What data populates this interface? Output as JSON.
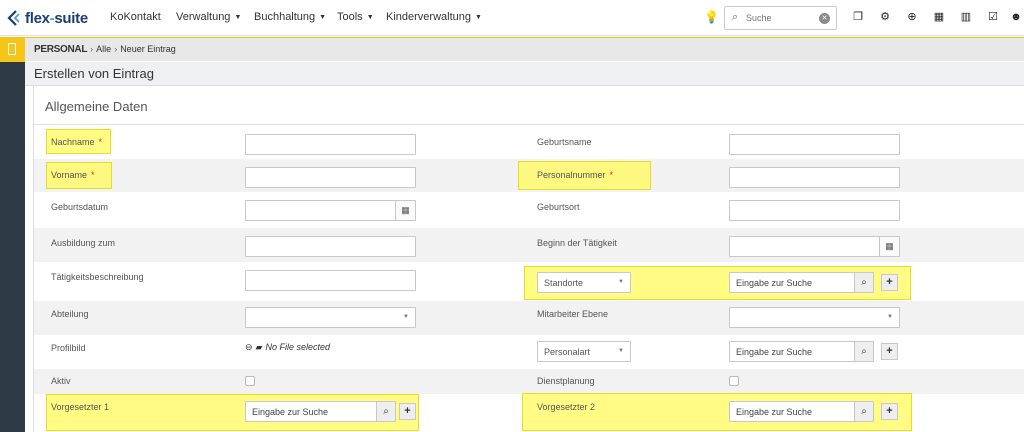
{
  "app": {
    "logo_text_a": "flex",
    "logo_text_dash": "-",
    "logo_text_b": "suite"
  },
  "nav": {
    "items": [
      {
        "label": "KoKontakt",
        "dropdown": false
      },
      {
        "label": "Verwaltung",
        "dropdown": true
      },
      {
        "label": "Buchhaltung",
        "dropdown": true
      },
      {
        "label": "Tools",
        "dropdown": true
      },
      {
        "label": "Kinderverwaltung",
        "dropdown": true
      }
    ],
    "search_placeholder": "Suche",
    "toolbar_icons": [
      "lightbulb-icon",
      "search-icon",
      "clear-icon",
      "documents-icon",
      "gear-icon",
      "plus-circle-icon",
      "calendar-icon",
      "bar-chart-icon",
      "checkbox-icon",
      "user-icon"
    ]
  },
  "breadcrumb": {
    "section": "PERSONAL",
    "level1": "Alle",
    "level2": "Neuer Eintrag"
  },
  "page": {
    "title": "Erstellen von Eintrag"
  },
  "form": {
    "section_title": "Allgemeine Daten",
    "required_mark": "*",
    "search_placeholder": "Eingabe zur Suche",
    "no_file": "No File selected",
    "fields": {
      "nachname": "Nachname",
      "geburtsname": "Geburtsname",
      "vorname": "Vorname",
      "personalnummer": "Personalnummer",
      "geburtsdatum": "Geburtsdatum",
      "geburtsort": "Geburtsort",
      "ausbildung_zum": "Ausbildung zum",
      "beginn_taetigkeit": "Beginn der Tätigkeit",
      "taetigkeitsbeschreibung": "Tätigkeitsbeschreibung",
      "standorte": "Standorte",
      "abteilung": "Abteilung",
      "mitarbeiter_ebene": "Mitarbeiter Ebene",
      "profilbild": "Profilbild",
      "personalart": "Personalart",
      "aktiv": "Aktiv",
      "dienstplanung": "Dienstplanung",
      "vorgesetzter1": "Vorgesetzter 1",
      "vorgesetzter2": "Vorgesetzter 2"
    }
  },
  "colors": {
    "highlight": "#fffa5a",
    "sidebar": "#2d3945",
    "sidebar_active": "#f5c518",
    "logo": "#1c3d72",
    "required": "#e0301e"
  }
}
